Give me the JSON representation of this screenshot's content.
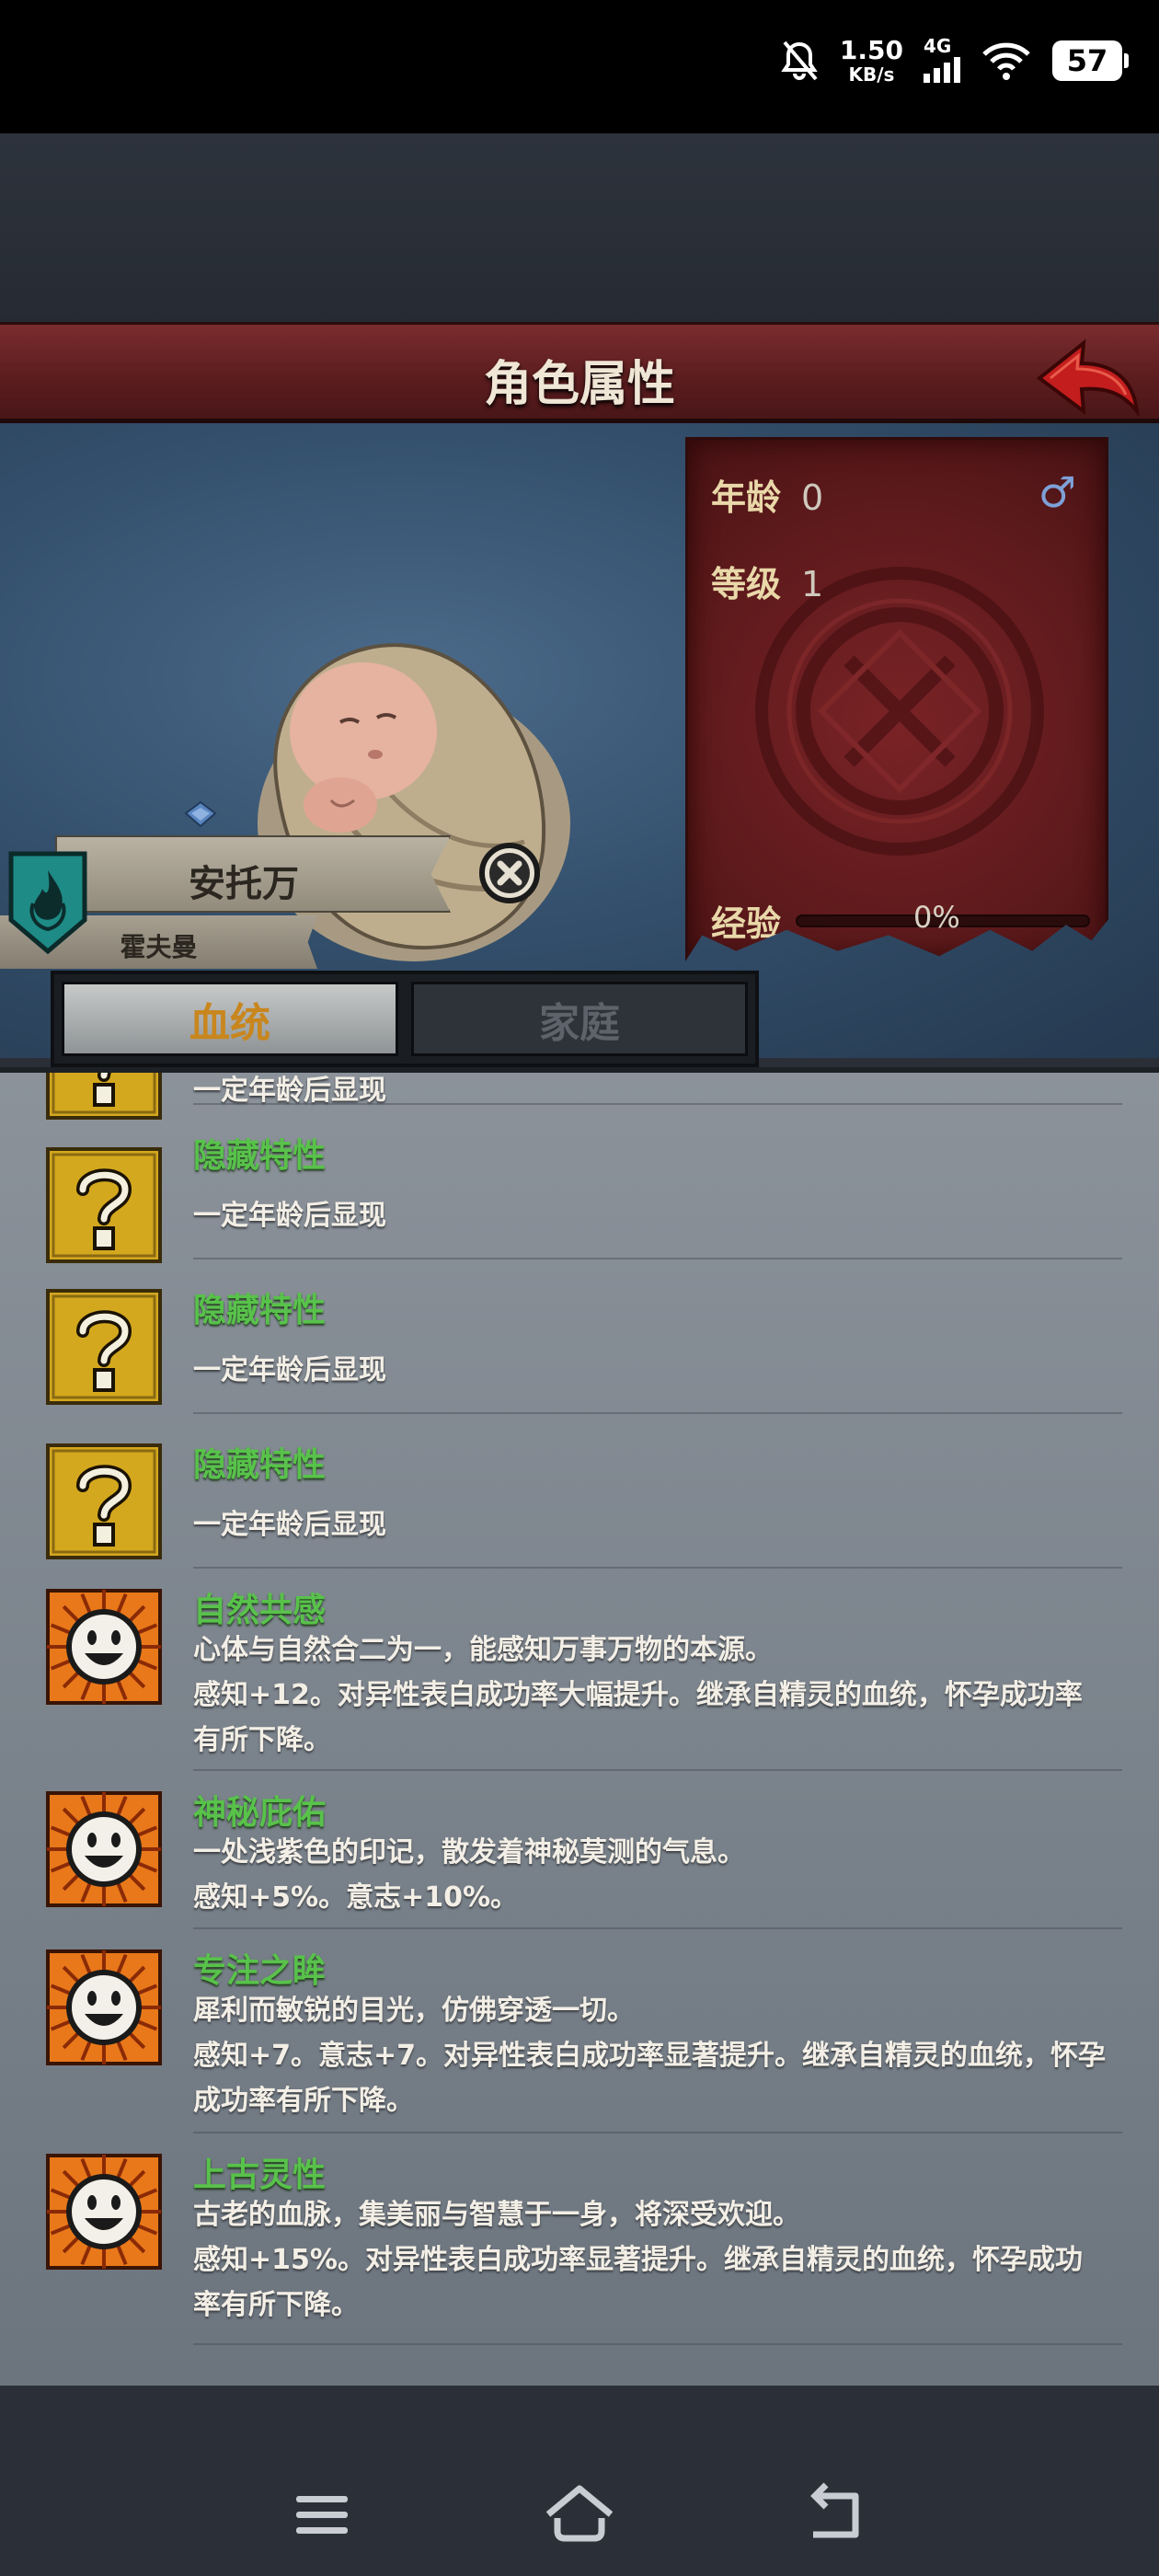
{
  "status_bar": {
    "speed_value": "1.50",
    "speed_unit": "KB/s",
    "network": "4G",
    "battery": "57"
  },
  "header": {
    "title": "角色属性",
    "back_icon": "back-arrow-icon"
  },
  "character": {
    "name": "安托万",
    "family": "霍夫曼",
    "age_label": "年龄",
    "age_value": "0",
    "gender_symbol": "♂",
    "level_label": "等级",
    "level_value": "1",
    "exp_label": "经验",
    "exp_percent": "0%",
    "exp_fraction": 0
  },
  "tabs": [
    {
      "label": "血统",
      "active": true
    },
    {
      "label": "家庭",
      "active": false
    }
  ],
  "traits": [
    {
      "type": "hidden",
      "name": "",
      "desc": "一定年龄后显现"
    },
    {
      "type": "hidden",
      "name": "隐藏特性",
      "desc": "一定年龄后显现"
    },
    {
      "type": "hidden",
      "name": "隐藏特性",
      "desc": "一定年龄后显现"
    },
    {
      "type": "hidden",
      "name": "隐藏特性",
      "desc": "一定年龄后显现"
    },
    {
      "type": "positive",
      "name": "自然共感",
      "desc": "心体与自然合二为一，能感知万事万物的本源。\n感知+12。对异性表白成功率大幅提升。继承自精灵的血统，怀孕成功率有所下降。"
    },
    {
      "type": "positive",
      "name": "神秘庇佑",
      "desc": "一处浅紫色的印记，散发着神秘莫测的气息。\n感知+5%。意志+10%。"
    },
    {
      "type": "positive",
      "name": "专注之眸",
      "desc": "犀利而敏锐的目光，仿佛穿透一切。\n感知+7。意志+7。对异性表白成功率显著提升。继承自精灵的血统，怀孕成功率有所下降。"
    },
    {
      "type": "positive",
      "name": "上古灵性",
      "desc": "古老的血脉，集美丽与智慧于一身，将深受欢迎。\n感知+15%。对异性表白成功率显著提升。继承自精灵的血统，怀孕成功率有所下降。"
    }
  ],
  "colors": {
    "trait_name": "#58c24a",
    "title_banner": "#6a2426",
    "active_tab_text": "#c8861d"
  }
}
